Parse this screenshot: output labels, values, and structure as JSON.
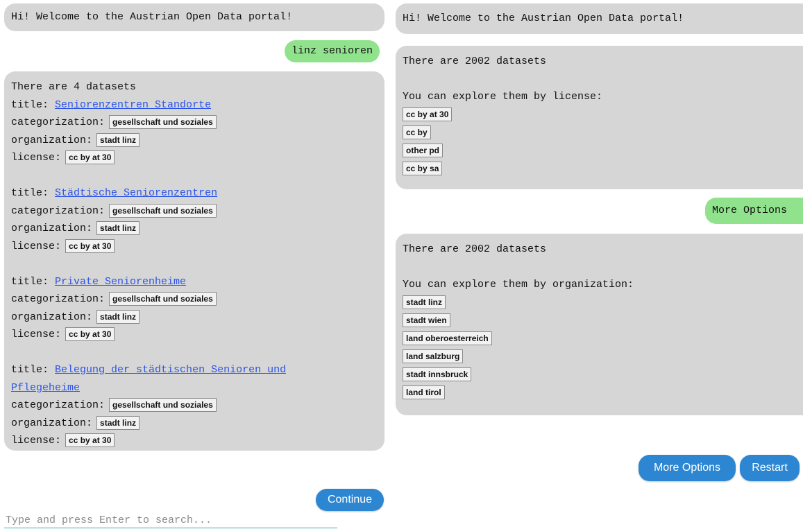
{
  "left": {
    "welcome": "Hi! Welcome to the Austrian Open Data portal!",
    "user_query": "linz senioren",
    "results_header": "There are 4 datasets",
    "labels": {
      "title": "title:",
      "categorization": "categorization:",
      "organization": "organization:",
      "license": "license:"
    },
    "datasets": [
      {
        "title": "Seniorenzentren Standorte",
        "categorization": "gesellschaft und soziales",
        "organization": "stadt linz",
        "license": "cc by at 30"
      },
      {
        "title": "Städtische Seniorenzentren",
        "categorization": "gesellschaft und soziales",
        "organization": "stadt linz",
        "license": "cc by at 30"
      },
      {
        "title": "Private Seniorenheime",
        "categorization": "gesellschaft und soziales",
        "organization": "stadt linz",
        "license": "cc by at 30"
      },
      {
        "title_line1": "Belegung der städtischen Senioren und",
        "title_line2": "Pflegeheime",
        "categorization": "gesellschaft und soziales",
        "organization": "stadt linz",
        "license": "cc by at 30"
      }
    ],
    "continue_label": "Continue",
    "search_placeholder": "Type and press Enter to search..."
  },
  "right": {
    "welcome": "Hi! Welcome to the Austrian Open Data portal!",
    "count_header": "There are 2002 datasets",
    "license_prompt": "You can explore them by license:",
    "licenses": [
      "cc by at 30",
      "cc by",
      "other pd",
      "cc by sa"
    ],
    "user_more_options": "More Options",
    "count_header_2": "There are 2002 datasets",
    "org_prompt": "You can explore them by organization:",
    "organizations": [
      "stadt linz",
      "stadt wien",
      "land oberoesterreich",
      "land salzburg",
      "stadt innsbruck",
      "land tirol"
    ],
    "more_options_label": "More Options",
    "restart_label": "Restart"
  },
  "colors": {
    "bot_bubble": "#d6d6d6",
    "user_bubble": "#90e28c",
    "link": "#2a53e8",
    "button": "#2d86d1"
  }
}
